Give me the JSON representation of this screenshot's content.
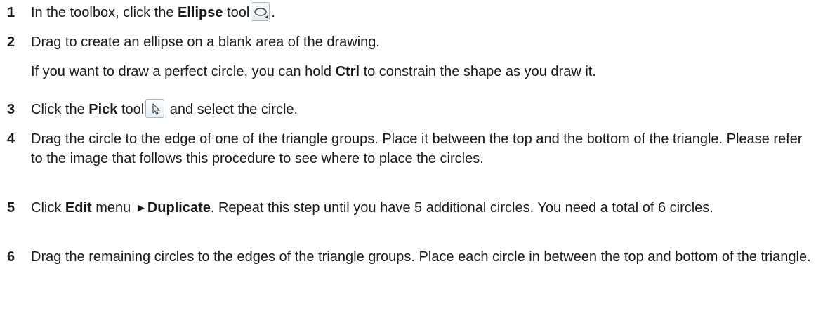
{
  "steps": [
    {
      "num": "1",
      "before": "In the toolbox, click the ",
      "bold": "Ellipse",
      "after": " tool",
      "tail": ".",
      "icon": "ellipse-tool-icon"
    },
    {
      "num": "2",
      "text": "Drag to create an ellipse on a blank area of the drawing."
    },
    {
      "note_before": "If you want to draw a perfect circle, you can hold ",
      "note_bold": "Ctrl",
      "note_after": " to constrain the shape as you draw it."
    },
    {
      "num": "3",
      "before": "Click the ",
      "bold": "Pick",
      "after": " tool",
      "tail": " and select the circle.",
      "icon": "pick-tool-icon"
    },
    {
      "num": "4",
      "text": "Drag the circle to the edge of one of the triangle groups. Place it between the top and the bottom of the triangle. Please refer to the image that follows this procedure to see where to place the circles."
    },
    {
      "num": "5",
      "pre": "Click ",
      "bold1": "Edit",
      "mid": " menu ",
      "arrow": "▶",
      "bold2": "Duplicate",
      "post": ". Repeat this step until you have 5 additional circles. You need a total of 6 circles."
    },
    {
      "num": "6",
      "text": "Drag the remaining circles to the edges of the triangle groups. Place each circle in between the top and bottom of the triangle."
    }
  ]
}
